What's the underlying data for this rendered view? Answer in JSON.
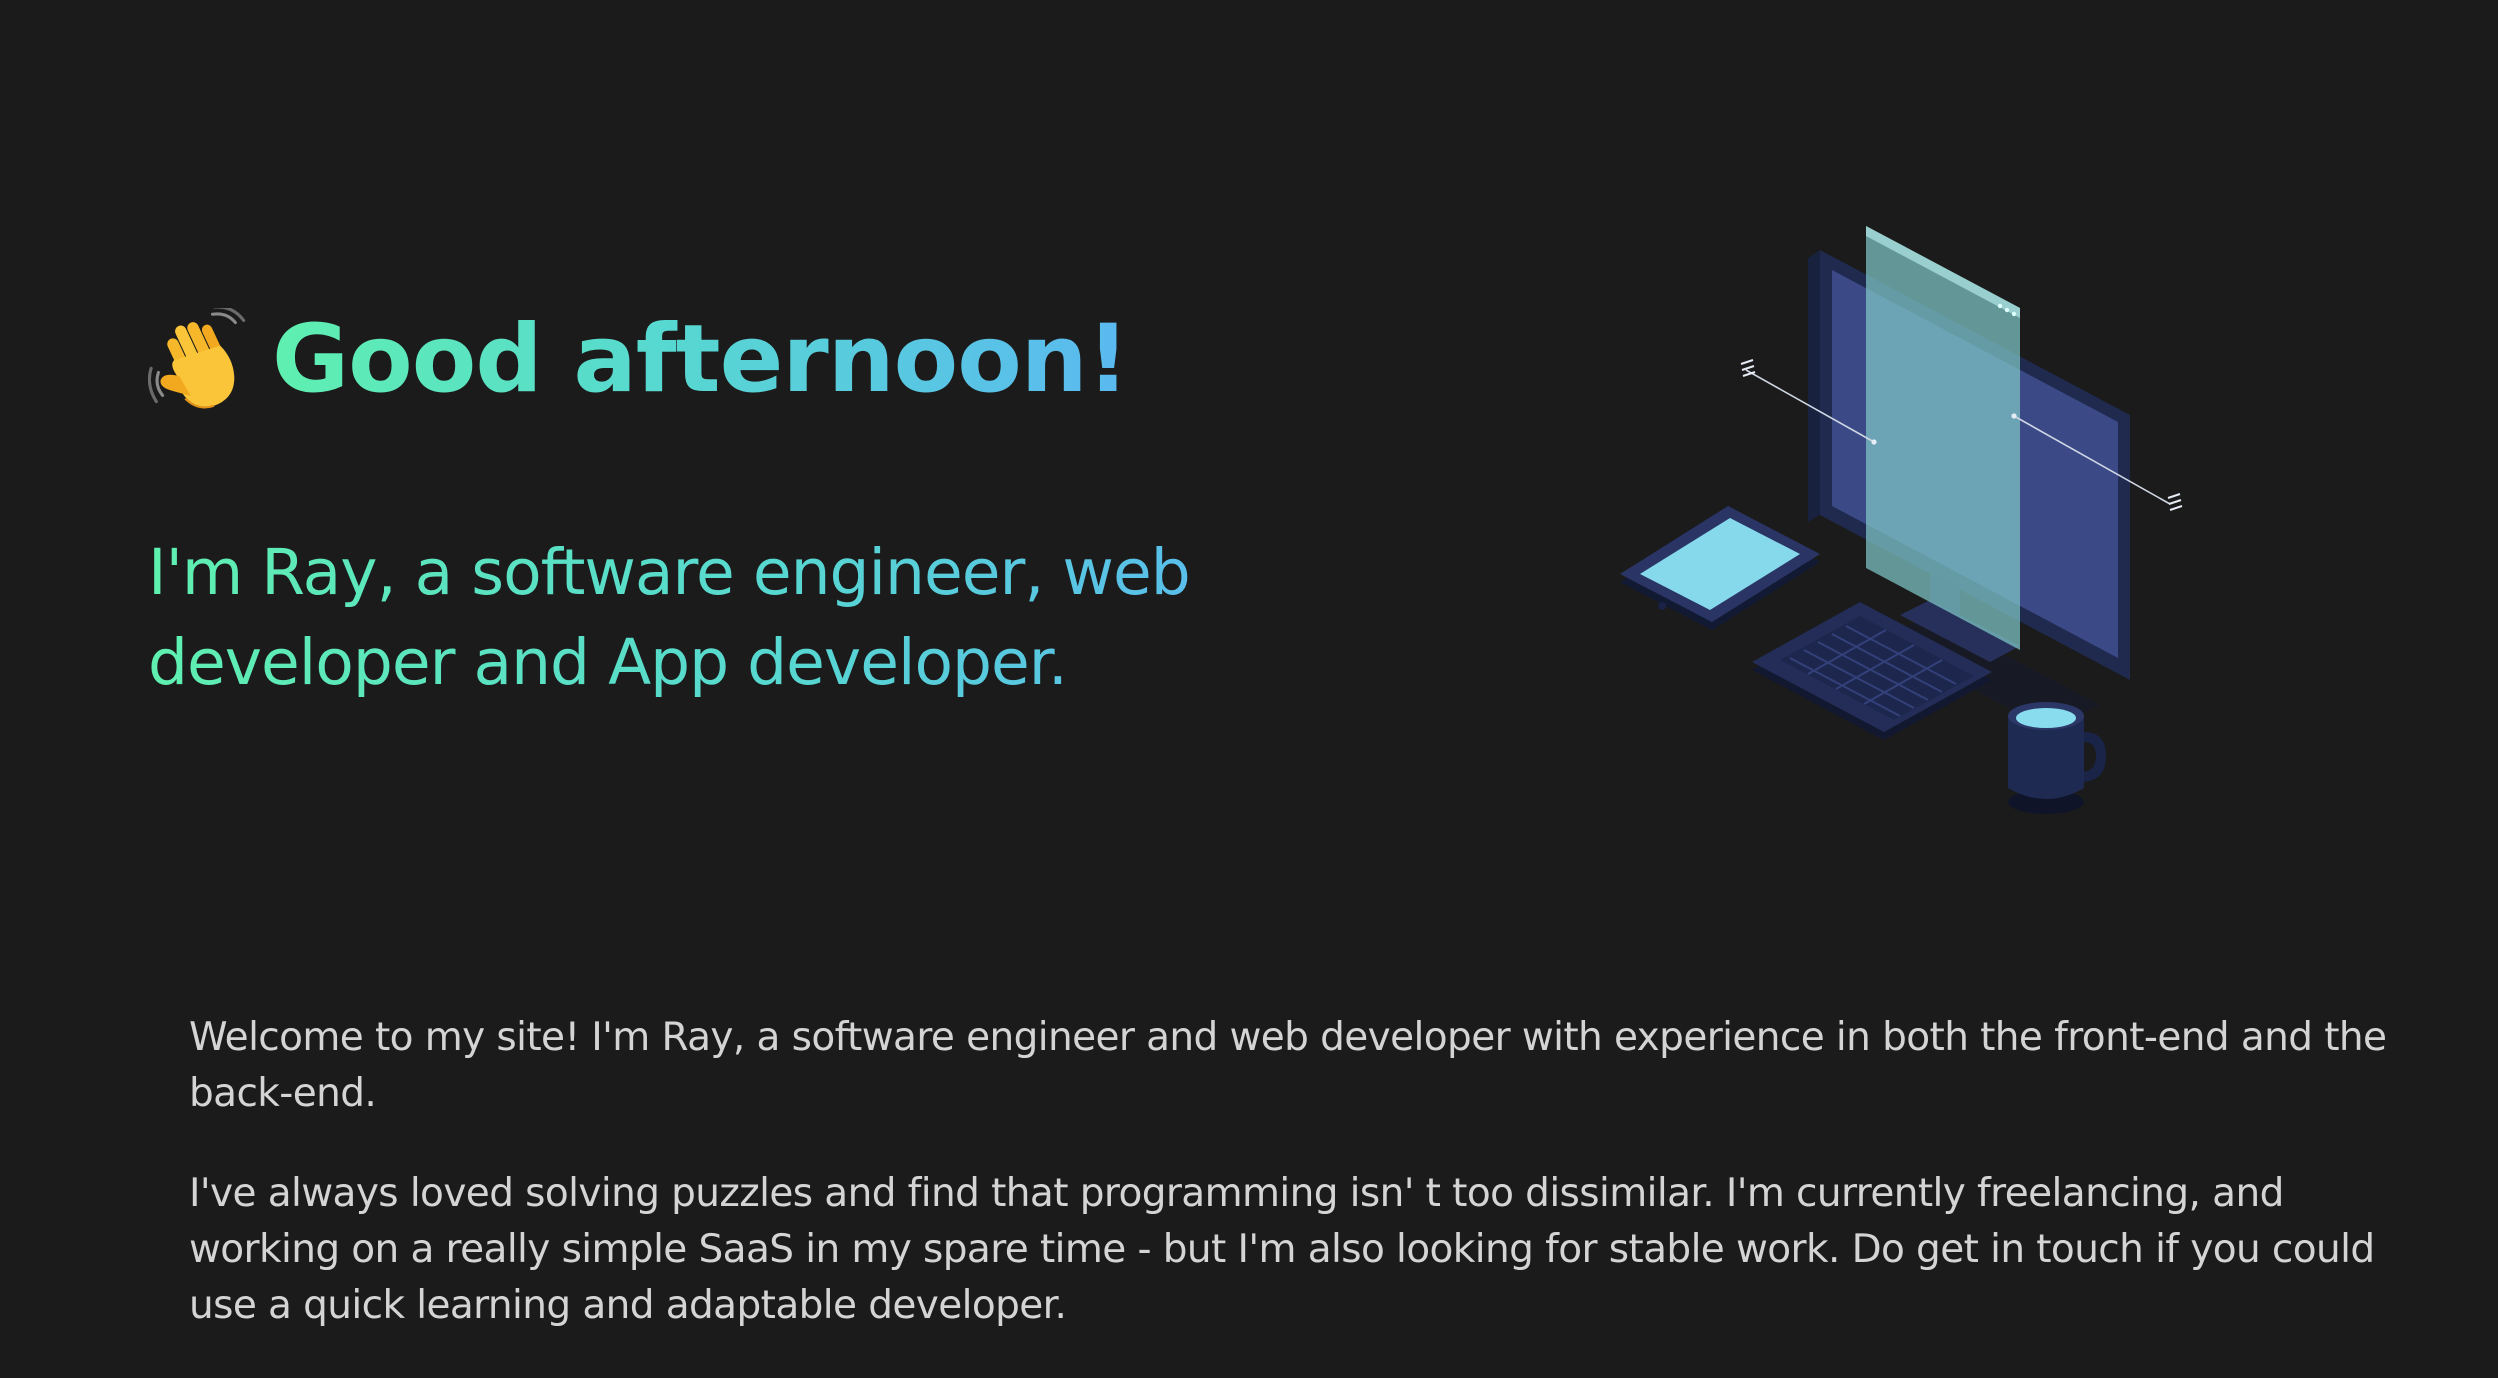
{
  "hero": {
    "greeting": "Good afternoon!",
    "tagline": "I'm Ray, a software engineer, web developer and App developer.",
    "wave_icon": "waving-hand-icon",
    "illustration": "isometric-workstation-illustration",
    "gradient_start": "#5ff0b0",
    "gradient_end": "#5ab9f0"
  },
  "about": {
    "paragraph_1": "Welcome to my site! I'm Ray, a software engineer and web developer with experience in both the front-end and the back-end.",
    "paragraph_2": "I've always loved solving puzzles and find that programming isn' t too dissimilar. I'm currently freelancing, and working on a really simple SaaS in my spare time - but I'm also looking for stable work. Do get in touch if you could use a quick learning and adaptable developer."
  },
  "colors": {
    "background": "#1b1b1b",
    "body_text": "#d4d4d4"
  }
}
